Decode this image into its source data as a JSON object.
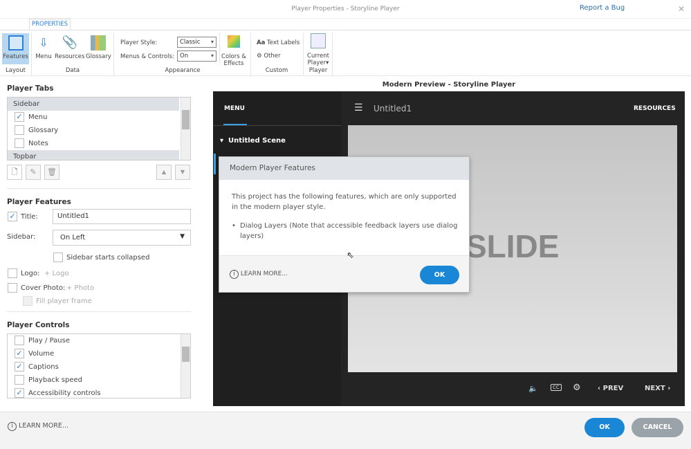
{
  "window": {
    "title": "Player Properties - Storyline Player",
    "report_bug": "Report a Bug",
    "close": "✕"
  },
  "ribbon": {
    "tab": "PROPERTIES",
    "features": "Features",
    "layout_group": "Layout",
    "menu": "Menu",
    "resources": "Resources",
    "glossary": "Glossary",
    "data_group": "Data",
    "player_style_label": "Player Style:",
    "player_style_value": "Classic",
    "menus_controls_label": "Menus & Controls:",
    "menus_controls_value": "On",
    "colors_effects_1": "Colors &",
    "colors_effects_2": "Effects",
    "appearance_group": "Appearance",
    "text_labels": "Text Labels",
    "other": "Other",
    "custom_group": "Custom",
    "current_player_1": "Current",
    "current_player_2": "Player",
    "player_group": "Player"
  },
  "player_tabs": {
    "heading": "Player Tabs",
    "group_sidebar": "Sidebar",
    "group_topbar": "Topbar",
    "items": [
      {
        "label": "Menu",
        "checked": true
      },
      {
        "label": "Glossary",
        "checked": false
      },
      {
        "label": "Notes",
        "checked": false
      }
    ]
  },
  "player_features": {
    "heading": "Player Features",
    "title_label": "Title:",
    "title_value": "Untitled1",
    "sidebar_label": "Sidebar:",
    "sidebar_value": "On Left",
    "sidebar_collapsed": "Sidebar starts collapsed",
    "logo_label": "Logo:",
    "logo_add": "+ Logo",
    "cover_label": "Cover Photo:",
    "cover_add": "+ Photo",
    "fill_frame": "Fill player frame"
  },
  "player_controls": {
    "heading": "Player Controls",
    "items": [
      {
        "label": "Play / Pause",
        "checked": false
      },
      {
        "label": "Volume",
        "checked": true
      },
      {
        "label": "Captions",
        "checked": true
      },
      {
        "label": "Playback speed",
        "checked": false
      },
      {
        "label": "Accessibility controls",
        "checked": true
      }
    ]
  },
  "preview": {
    "heading": "Modern Preview - Storyline Player",
    "menu_tab": "MENU",
    "scene": "Untitled Scene",
    "course_title": "Untitled1",
    "resources": "RESOURCES",
    "slide_text": "SLIDE",
    "prev": "PREV",
    "next": "NEXT"
  },
  "dialog": {
    "title": "Modern Player Features",
    "body": "This project has the following features, which are only supported in the modern player style.",
    "bullet": "Dialog Layers (Note that accessible feedback layers use dialog layers)",
    "learn_more": "LEARN MORE...",
    "ok": "OK"
  },
  "footer": {
    "learn_more": "LEARN MORE...",
    "ok": "OK",
    "cancel": "CANCEL"
  },
  "colors": {
    "accent": "#1a86d6",
    "cancel": "#9aa3aa"
  }
}
